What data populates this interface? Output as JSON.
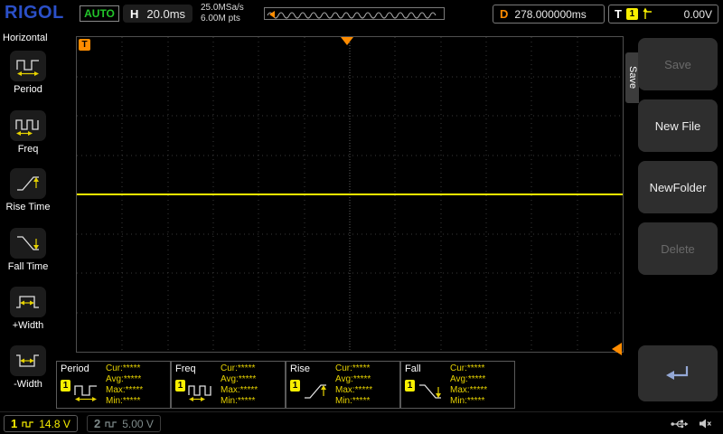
{
  "top_bar": {
    "logo": "RIGOL",
    "run_status": "AUTO",
    "horizontal": {
      "label": "H",
      "timebase": "20.0ms"
    },
    "acquisition": {
      "sample_rate": "25.0MSa/s",
      "memory_depth": "6.00M pts"
    },
    "delay": {
      "label": "D",
      "value": "278.000000ms"
    },
    "trigger": {
      "label": "T",
      "channel": "1",
      "edge_icon": "rising-edge-icon",
      "level": "0.00V"
    }
  },
  "left_menu": {
    "title": "Horizontal",
    "items": [
      {
        "label": "Period",
        "icon": "period-icon"
      },
      {
        "label": "Freq",
        "icon": "freq-icon"
      },
      {
        "label": "Rise Time",
        "icon": "rise-time-icon"
      },
      {
        "label": "Fall Time",
        "icon": "fall-time-icon"
      },
      {
        "label": "+Width",
        "icon": "plus-width-icon"
      },
      {
        "label": "-Width",
        "icon": "minus-width-icon"
      }
    ]
  },
  "grid": {
    "trigger_marker_label": "T",
    "trace": {
      "channel": "1",
      "description": "flat horizontal yellow line at vertical center"
    }
  },
  "right_menu": {
    "tab_label": "Save",
    "buttons": [
      {
        "label": "Save",
        "enabled": false
      },
      {
        "label": "New File",
        "enabled": true
      },
      {
        "label": "NewFolder",
        "enabled": true
      },
      {
        "label": "Delete",
        "enabled": false
      },
      {
        "label": "",
        "icon": "return-arrow-icon",
        "enabled": true
      }
    ]
  },
  "measurements": [
    {
      "name": "Period",
      "channel": "1",
      "icon": "period-icon",
      "rows": [
        "Cur:*****",
        "Avg:*****",
        "Max:*****",
        "Min:*****"
      ]
    },
    {
      "name": "Freq",
      "channel": "1",
      "icon": "freq-icon",
      "rows": [
        "Cur:*****",
        "Avg:*****",
        "Max:*****",
        "Min:*****"
      ]
    },
    {
      "name": "Rise",
      "channel": "1",
      "icon": "rise-time-icon",
      "rows": [
        "Cur:*****",
        "Avg:*****",
        "Max:*****",
        "Min:*****"
      ]
    },
    {
      "name": "Fall",
      "channel": "1",
      "icon": "fall-time-icon",
      "rows": [
        "Cur:*****",
        "Avg:*****",
        "Max:*****",
        "Min:*****"
      ]
    }
  ],
  "status_bar": {
    "channel1": {
      "number": "1",
      "scale": "14.8 V",
      "color": "#f8ef00"
    },
    "channel2": {
      "number": "2",
      "scale": "5.00 V",
      "color": "#7f8b8b"
    },
    "icons": [
      "usb-icon",
      "speaker-icon"
    ]
  },
  "colors": {
    "background": "#000000",
    "channel1_yellow": "#f8ef00",
    "accent_orange": "#ff8c00",
    "auto_green": "#22c52a",
    "logo_blue": "#2b50c8",
    "menu_button_bg": "#2e2e2e",
    "disabled_text": "#6a6a6a"
  }
}
